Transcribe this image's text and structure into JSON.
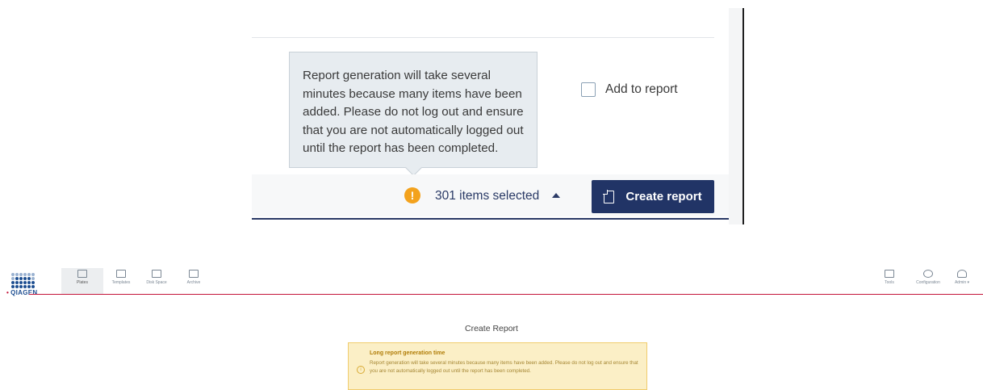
{
  "zoom_panel": {
    "tooltip": "Report generation will take several minutes because many items have been added. Please do not log out and ensure that you are not automatically logged out until the report has been completed.",
    "add_to_report_label": "Add to report",
    "add_to_report_checked": false,
    "selection_count_text": "301 items selected",
    "create_report_button": "Create report",
    "icons": {
      "warning": "exclamation-circle-icon",
      "caret": "caret-up-icon",
      "button": "document-icon"
    },
    "colors": {
      "primary": "#213466",
      "warning": "#f3a21d"
    }
  },
  "app_header": {
    "brand": "QIAGEN",
    "nav": [
      {
        "label": "Plates",
        "active": true
      },
      {
        "label": "Templates",
        "active": false
      },
      {
        "label": "Disk Space",
        "active": false
      },
      {
        "label": "Archive",
        "active": false
      }
    ],
    "right_nav": [
      {
        "label": "Tools"
      },
      {
        "label": "Configuration"
      },
      {
        "label": "Admin ▾"
      }
    ],
    "accent_color": "#c4163b"
  },
  "page": {
    "title": "Create Report",
    "notice": {
      "title": "Long report generation time",
      "body": "Report generation will take several minutes because many items have been added. Please do not log out and ensure that you are not automatically logged out until the report has been completed."
    }
  }
}
